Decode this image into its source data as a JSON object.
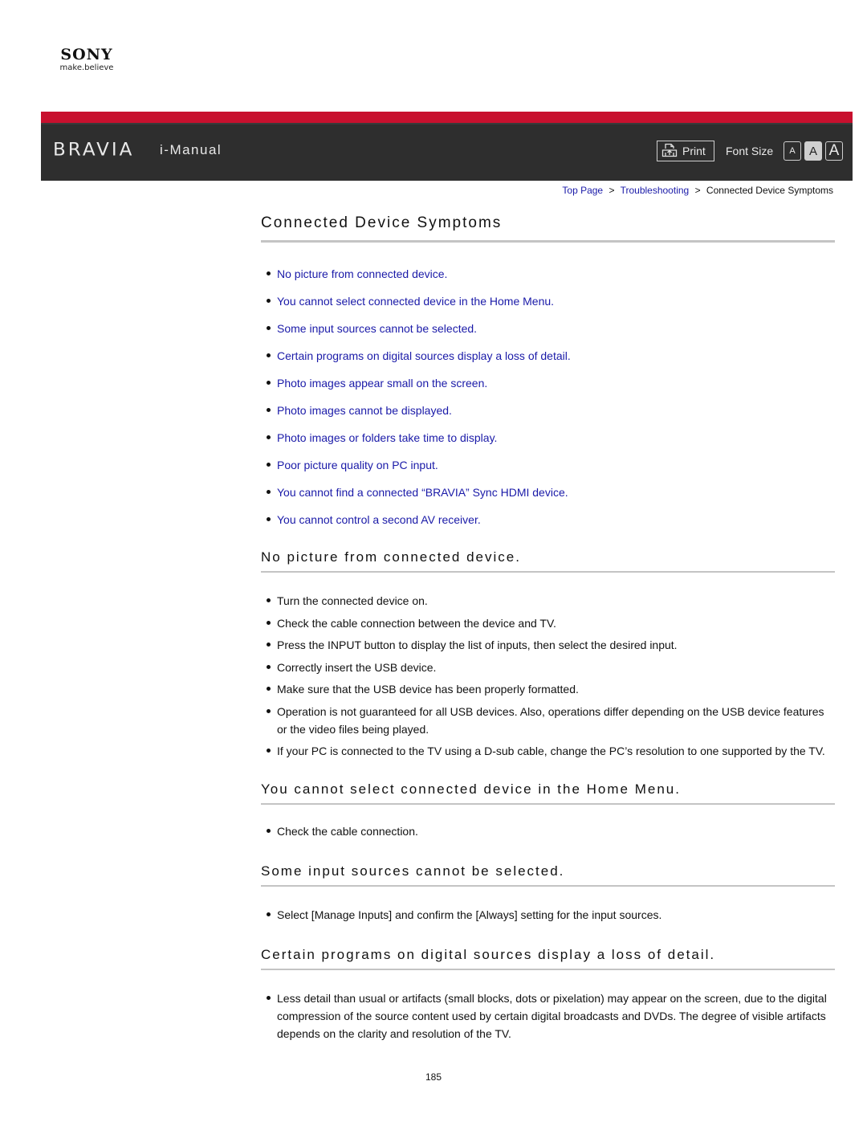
{
  "brand": {
    "logo": "SONY",
    "tagline": "make.believe"
  },
  "header": {
    "product": "BRAVIA",
    "title": "i-Manual",
    "print_label": "Print",
    "print_icon": "print-icon",
    "font_size_label": "Font Size",
    "font_size_buttons": [
      "A",
      "A",
      "A"
    ],
    "accent_color": "#c8102e",
    "bar_color": "#2e2e2e"
  },
  "breadcrumb": {
    "items": [
      "Top Page",
      "Troubleshooting"
    ],
    "separator": ">",
    "current": "Connected Device Symptoms"
  },
  "page": {
    "title": "Connected Device Symptoms",
    "links": [
      "No picture from connected device.",
      "You cannot select connected device in the Home Menu.",
      "Some input sources cannot be selected.",
      "Certain programs on digital sources display a loss of detail.",
      "Photo images appear small on the screen.",
      "Photo images cannot be displayed.",
      "Photo images or folders take time to display.",
      "Poor picture quality on PC input.",
      "You cannot find a connected “BRAVIA” Sync HDMI device.",
      "You cannot control a second AV receiver."
    ],
    "sections": [
      {
        "title": "No picture from connected device.",
        "items": [
          "Turn the connected device on.",
          "Check the cable connection between the device and TV.",
          "Press the INPUT button to display the list of inputs, then select the desired input.",
          "Correctly insert the USB device.",
          "Make sure that the USB device has been properly formatted.",
          "Operation is not guaranteed for all USB devices. Also, operations differ depending on the USB device features or the video files being played.",
          "If your PC is connected to the TV using a D-sub cable, change the PC’s resolution to one supported by the TV."
        ]
      },
      {
        "title": "You cannot select connected device in the Home Menu.",
        "items": [
          "Check the cable connection."
        ]
      },
      {
        "title": "Some input sources cannot be selected.",
        "items": [
          "Select [Manage Inputs] and confirm the [Always] setting for the input sources."
        ]
      },
      {
        "title": "Certain programs on digital sources display a loss of detail.",
        "items": [
          "Less detail than usual or artifacts (small blocks, dots or pixelation) may appear on the screen, due to the digital compression of the source content used by certain digital broadcasts and DVDs. The degree of visible artifacts depends on the clarity and resolution of the TV."
        ]
      }
    ],
    "page_number": "185",
    "link_color": "#1a1aa8"
  }
}
